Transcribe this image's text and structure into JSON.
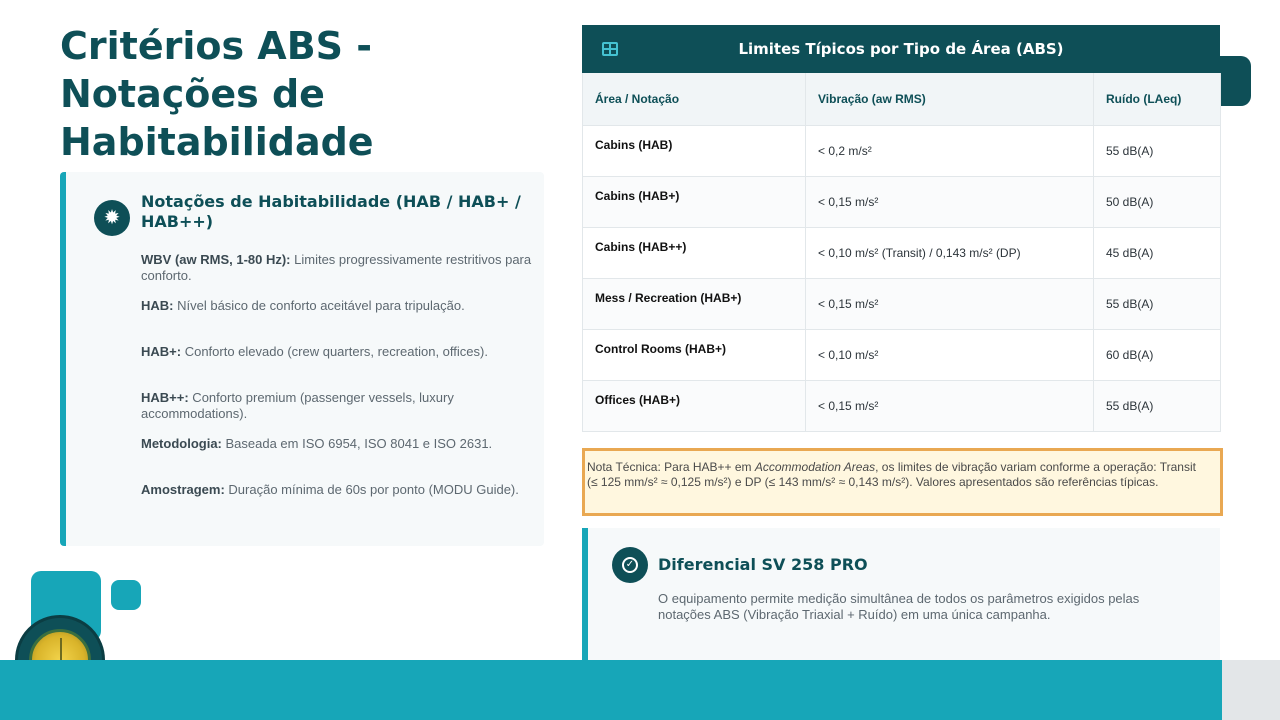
{
  "title": "Critérios ABS - Notações de Habitabilidade",
  "left_card": {
    "icon": "gear-icon",
    "heading": "Notações de Habitabilidade (HAB / HAB+ / HAB++)",
    "criteria": [
      {
        "label": "WBV (aw RMS, 1-80 Hz):",
        "text": " Limites progressivamente restritivos para conforto."
      },
      {
        "label": "HAB:",
        "text": " Nível básico de conforto aceitável para tripulação."
      },
      {
        "label": "HAB+:",
        "text": " Conforto elevado (crew quarters, recreation, offices)."
      },
      {
        "label": "HAB++:",
        "text": " Conforto premium (passenger vessels, luxury accommodations)."
      },
      {
        "label": "Metodologia:",
        "text": " Baseada em ISO 6954, ISO 8041 e ISO 2631."
      },
      {
        "label": "Amostragem:",
        "text": " Duração mínima de 60s por ponto (MODU Guide)."
      }
    ]
  },
  "table": {
    "icon": "table-icon",
    "title": "Limites Típicos por Tipo de Área (ABS)",
    "headers": [
      "Área / Notação",
      "Vibração (aw RMS)",
      "Ruído (LAeq)"
    ],
    "rows": [
      [
        "Cabins (HAB)",
        "< 0,2 m/s²",
        "55 dB(A)"
      ],
      [
        "Cabins (HAB+)",
        "< 0,15 m/s²",
        "50 dB(A)"
      ],
      [
        "Cabins (HAB++)",
        "< 0,10 m/s² (Transit) / 0,143 m/s² (DP)",
        "45 dB(A)"
      ],
      [
        "Mess / Recreation (HAB+)",
        "< 0,15 m/s²",
        "55 dB(A)"
      ],
      [
        "Control Rooms (HAB+)",
        "< 0,10 m/s²",
        "60 dB(A)"
      ],
      [
        "Offices (HAB+)",
        "< 0,15 m/s²",
        "55 dB(A)"
      ]
    ]
  },
  "note": {
    "prefix": "Nota Técnica: Para HAB++ em ",
    "emphasis": "Accommodation Areas",
    "suffix": ", os limites de vibração variam conforme a operação: Transit (≤ 125 mm/s² ≈ 0,125 m/s²) e DP (≤ 143 mm/s² ≈ 0,143 m/s²). Valores apresentados são referências típicas."
  },
  "differential": {
    "icon": "check-circle-icon",
    "title": "Diferencial SV 258 PRO",
    "text": "O equipamento permite medição simultânea de todos os parâmetros exigidos pelas notações ABS (Vibração Triaxial + Ruído) em uma única campanha."
  },
  "colors": {
    "primary": "#0e4f57",
    "accent": "#17a6b8",
    "note_border": "#e9a852",
    "note_bg": "#fff7df"
  }
}
